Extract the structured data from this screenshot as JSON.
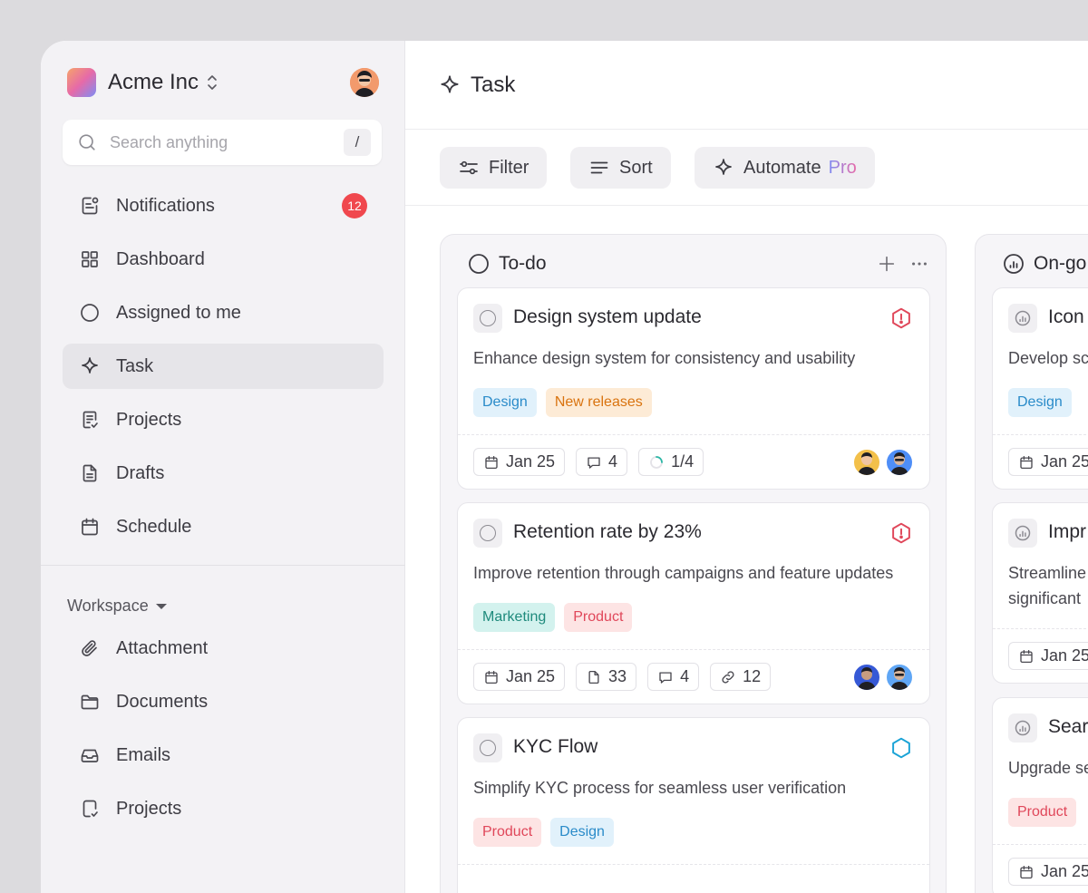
{
  "org": {
    "name": "Acme Inc"
  },
  "search": {
    "placeholder": "Search anything",
    "shortcut": "/"
  },
  "nav": {
    "items": [
      {
        "label": "Notifications",
        "badge": "12"
      },
      {
        "label": "Dashboard"
      },
      {
        "label": "Assigned to me"
      },
      {
        "label": "Task"
      },
      {
        "label": "Projects"
      },
      {
        "label": "Drafts"
      },
      {
        "label": "Schedule"
      }
    ]
  },
  "workspace": {
    "label": "Workspace",
    "items": [
      {
        "label": "Attachment"
      },
      {
        "label": "Documents"
      },
      {
        "label": "Emails"
      },
      {
        "label": "Projects"
      }
    ]
  },
  "header": {
    "title": "Task"
  },
  "toolbar": {
    "filter": "Filter",
    "sort": "Sort",
    "automate": "Automate",
    "pro": "Pro"
  },
  "columns": [
    {
      "title": "To-do",
      "cards": [
        {
          "title": "Design system update",
          "description": "Enhance design system for consistency and usability",
          "tags": [
            "Design",
            "New releases"
          ],
          "date": "Jan 25",
          "comments": "4",
          "progress": "1/4",
          "progress_fraction": 0.25
        },
        {
          "title": "Retention rate by 23%",
          "description": "Improve retention through campaigns and feature updates",
          "tags": [
            "Marketing",
            "Product"
          ],
          "date": "Jan 25",
          "files": "33",
          "comments": "4",
          "links": "12"
        },
        {
          "title": "KYC Flow",
          "description": "Simplify KYC process for seamless user verification",
          "tags": [
            "Product",
            "Design"
          ]
        }
      ]
    },
    {
      "title": "On-go",
      "cards": [
        {
          "title": "Icon",
          "description": "Develop sc",
          "tags": [
            "Design"
          ],
          "date": "Jan 25"
        },
        {
          "title": "Impr",
          "description": "Streamline",
          "description2": "significant",
          "date": "Jan 25"
        },
        {
          "title": "Sear",
          "description": "Upgrade se",
          "tags": [
            "Product"
          ],
          "date": "Jan 25"
        }
      ]
    }
  ],
  "colors": {
    "tag_design_bg": "#e1f1fb",
    "tag_design_fg": "#2a8bc9",
    "tag_release_bg": "#fdebd6",
    "tag_release_fg": "#d9730f",
    "tag_marketing_bg": "#d3f2ee",
    "tag_marketing_fg": "#1e8a7c",
    "tag_product_bg": "#fde4e4",
    "tag_product_fg": "#e0475a",
    "badge": "#f0484e"
  }
}
